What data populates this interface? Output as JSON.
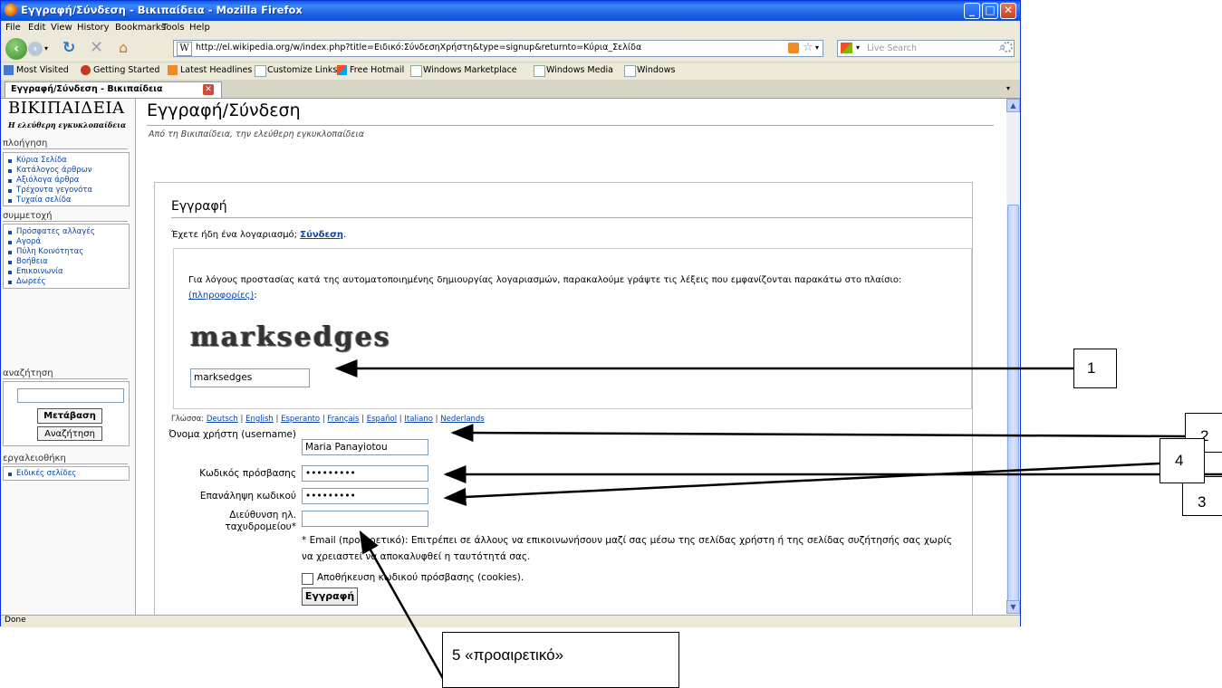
{
  "window": {
    "title": "Εγγραφή/Σύνδεση - Βικιπαίδεια - Mozilla Firefox"
  },
  "menu": [
    "File",
    "Edit",
    "View",
    "History",
    "Bookmarks",
    "Tools",
    "Help"
  ],
  "nav": {
    "url": "http://el.wikipedia.org/w/index.php?title=Ειδικό:ΣύνδεσηΧρήστη&type=signup&returnto=Κύρια_Σελίδα",
    "search_placeholder": "Live Search"
  },
  "bookmarks": [
    "Most Visited",
    "Getting Started",
    "Latest Headlines",
    "Customize Links",
    "Free Hotmail",
    "Windows Marketplace",
    "Windows Media",
    "Windows"
  ],
  "tab": {
    "label": "Εγγραφή/Σύνδεση - Βικιπαίδεια"
  },
  "sidebar": {
    "logo": "ΒΙΚΙΠΑΙΔΕΙΑ",
    "tagline": "Η ελεύθερη εγκυκλοπαίδεια",
    "nav_title": "πλοήγηση",
    "nav_items": [
      "Κύρια Σελίδα",
      "Κατάλογος άρθρων",
      "Αξιόλογα άρθρα",
      "Τρέχοντα γεγονότα",
      "Τυχαία σελίδα"
    ],
    "participate_title": "συμμετοχή",
    "participate_items": [
      "Πρόσφατες αλλαγές",
      "Αγορά",
      "Πύλη Κοινότητας",
      "Βοήθεια",
      "Επικοινωνία",
      "Δωρεές"
    ],
    "search_title": "αναζήτηση",
    "go_button": "Μετάβαση",
    "search_button": "Αναζήτηση",
    "tools_title": "εργαλειοθήκη",
    "tools_items": [
      "Ειδικές σελίδες"
    ]
  },
  "page": {
    "title": "Εγγραφή/Σύνδεση",
    "subtitle": "Από τη Βικιπαίδεια, την ελεύθερη εγκυκλοπαίδεια",
    "form_title": "Εγγραφή",
    "have_account": "Έχετε ήδη ένα λογαριασμό;",
    "login_link": "Σύνδεση",
    "captcha_intro": "Για λόγους προστασίας κατά της αυτοματοποιημένης δημιουργίας λογαριασμών, παρακαλούμε γράψτε τις λέξεις που εμφανίζονται παρακάτω στο πλαίσιο:",
    "captcha_info_link": "(πληροφορίες)",
    "captcha_word": "marksedges",
    "captcha_value": "marksedges",
    "language_label": "Γλώσσα:",
    "languages": [
      "Deutsch",
      "English",
      "Esperanto",
      "Français",
      "Español",
      "Italiano",
      "Nederlands"
    ],
    "username_label": "Όνομα χρήστη (username)",
    "username_value": "Maria Panayiotou",
    "password_label": "Κωδικός πρόσβασης",
    "password_value": "•••••••••",
    "retype_label": "Επανάληψη κωδικού",
    "retype_value": "•••••••••",
    "email_label": "Διεύθυνση ηλ. ταχυδρομείου*",
    "email_value": "",
    "email_note": "* Email (προαιρετικό): Επιτρέπει σε άλλους να επικοινωνήσουν μαζί σας μέσω της σελίδας χρήστη ή της σελίδας συζήτησής σας χωρίς να χρειαστεί να αποκαλυφθεί η ταυτότητά σας.",
    "remember_label": "Αποθήκευση κωδικού πρόσβασης (cookies).",
    "register_button": "Εγγραφή"
  },
  "status": "Done",
  "annotations": {
    "c1": "1",
    "c2": "2",
    "c3": "3",
    "c4": "4",
    "c5": "5 «προαιρετικό»"
  }
}
